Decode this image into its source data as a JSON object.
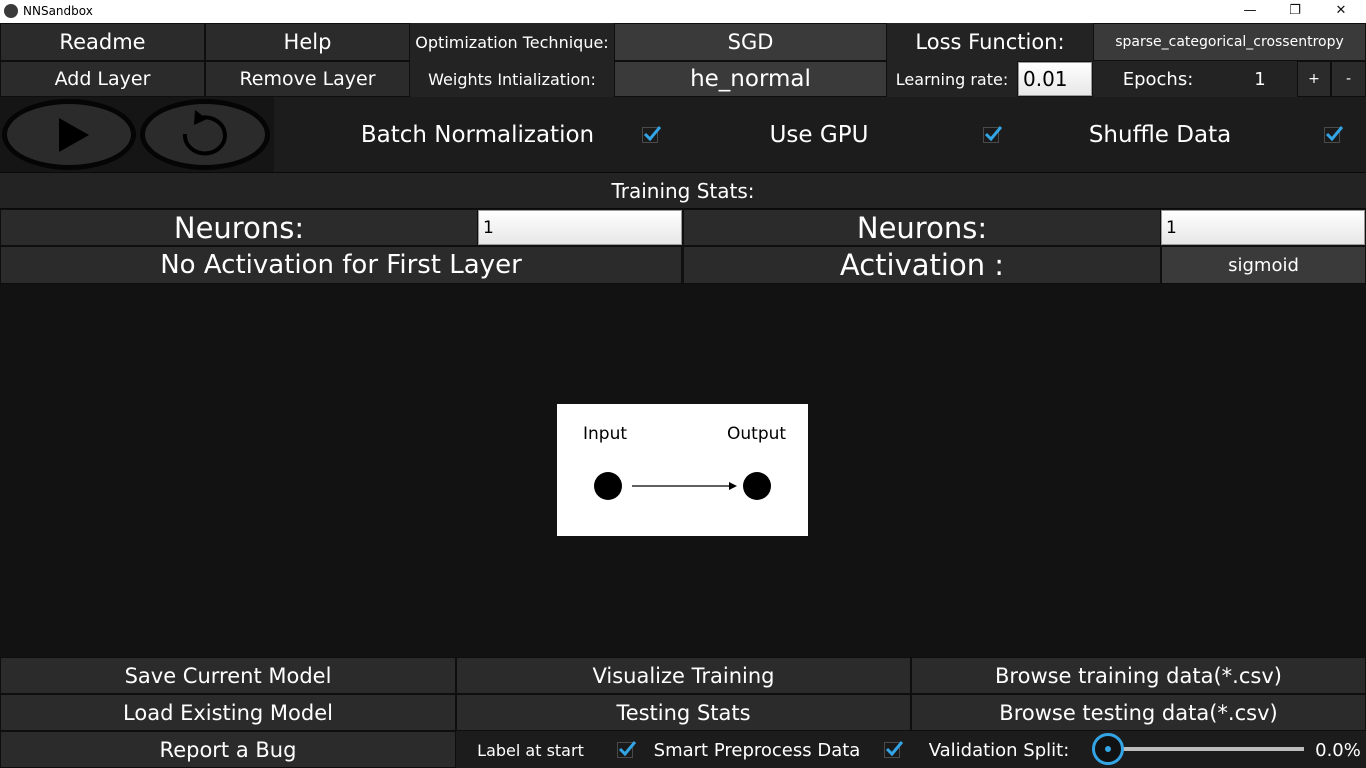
{
  "window": {
    "title": "NNSandbox",
    "minimize": "—",
    "maximize": "❐",
    "close": "✕"
  },
  "toolbar": {
    "readme": "Readme",
    "help": "Help",
    "add_layer": "Add Layer",
    "remove_layer": "Remove Layer",
    "optimization_label": "Optimization Technique:",
    "optimization_value": "SGD",
    "weights_label": "Weights Intialization:",
    "weights_value": "he_normal",
    "loss_label": "Loss Function:",
    "loss_value": "sparse_categorical_crossentropy",
    "lr_label": "Learning rate:",
    "lr_value": "0.01",
    "epochs_label": "Epochs:",
    "epochs_value": "1",
    "plus": "+",
    "minus": "-"
  },
  "options": {
    "batch_norm": "Batch Normalization",
    "batch_norm_checked": true,
    "use_gpu": "Use GPU",
    "use_gpu_checked": true,
    "shuffle": "Shuffle Data",
    "shuffle_checked": true
  },
  "stats": {
    "title": "Training Stats:"
  },
  "layers": {
    "left": {
      "neurons_label": "Neurons:",
      "neurons_value": "1",
      "activation_text": "No Activation for First Layer"
    },
    "right": {
      "neurons_label": "Neurons:",
      "neurons_value": "1",
      "activation_label": "Activation :",
      "activation_value": "sigmoid"
    }
  },
  "diagram": {
    "input": "Input",
    "output": "Output"
  },
  "bottom": {
    "save_model": "Save Current Model",
    "visualize": "Visualize Training",
    "browse_train": "Browse training data(*.csv)",
    "load_model": "Load Existing Model",
    "testing_stats": "Testing Stats",
    "browse_test": "Browse testing data(*.csv)",
    "report_bug": "Report a Bug",
    "label_at_start": "Label at start",
    "label_at_start_checked": true,
    "smart_preprocess": "Smart Preprocess Data",
    "smart_preprocess_checked": true,
    "validation_label": "Validation Split:",
    "validation_value": "0.0%",
    "validation_fraction": 0.0
  },
  "colors": {
    "accent": "#33a5e5",
    "button": "#2b2b2b",
    "background": "#121212"
  }
}
